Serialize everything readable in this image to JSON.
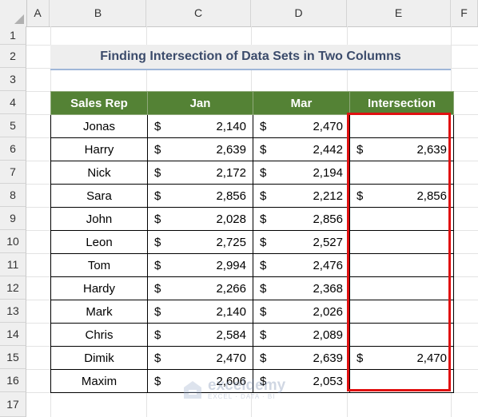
{
  "columns": [
    "A",
    "B",
    "C",
    "D",
    "E",
    "F"
  ],
  "rows": [
    "1",
    "2",
    "3",
    "4",
    "5",
    "6",
    "7",
    "8",
    "9",
    "10",
    "11",
    "12",
    "13",
    "14",
    "15",
    "16",
    "17"
  ],
  "title": "Finding Intersection of Data Sets in Two Columns",
  "table": {
    "headers": [
      "Sales Rep",
      "Jan",
      "Mar",
      "Intersection"
    ],
    "currency_symbol": "$",
    "rows": [
      {
        "rep": "Jonas",
        "jan": "2,140",
        "mar": "2,470",
        "intersection": ""
      },
      {
        "rep": "Harry",
        "jan": "2,639",
        "mar": "2,442",
        "intersection": "2,639"
      },
      {
        "rep": "Nick",
        "jan": "2,172",
        "mar": "2,194",
        "intersection": ""
      },
      {
        "rep": "Sara",
        "jan": "2,856",
        "mar": "2,212",
        "intersection": "2,856"
      },
      {
        "rep": "John",
        "jan": "2,028",
        "mar": "2,856",
        "intersection": ""
      },
      {
        "rep": "Leon",
        "jan": "2,725",
        "mar": "2,527",
        "intersection": ""
      },
      {
        "rep": "Tom",
        "jan": "2,994",
        "mar": "2,476",
        "intersection": ""
      },
      {
        "rep": "Hardy",
        "jan": "2,266",
        "mar": "2,368",
        "intersection": ""
      },
      {
        "rep": "Mark",
        "jan": "2,140",
        "mar": "2,026",
        "intersection": ""
      },
      {
        "rep": "Chris",
        "jan": "2,584",
        "mar": "2,089",
        "intersection": ""
      },
      {
        "rep": "Dimik",
        "jan": "2,470",
        "mar": "2,639",
        "intersection": "2,470"
      },
      {
        "rep": "Maxim",
        "jan": "2,606",
        "mar": "2,053",
        "intersection": ""
      }
    ]
  },
  "watermark": {
    "main": "exceldemy",
    "sub": "EXCEL · DATA · BI"
  },
  "colors": {
    "header_green": "#548235",
    "highlight_red": "#e01010",
    "title_text": "#3b4b6b"
  }
}
